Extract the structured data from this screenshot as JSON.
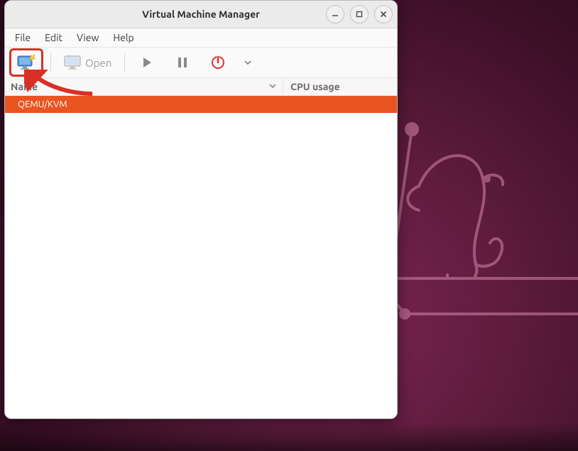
{
  "window": {
    "title": "Virtual Machine Manager"
  },
  "menubar": {
    "file": "File",
    "edit": "Edit",
    "view": "View",
    "help": "Help"
  },
  "toolbar": {
    "open_label": "Open"
  },
  "columns": {
    "name": "Name",
    "cpu": "CPU usage"
  },
  "connections": [
    {
      "name": "QEMU/KVM",
      "selected": true
    }
  ]
}
